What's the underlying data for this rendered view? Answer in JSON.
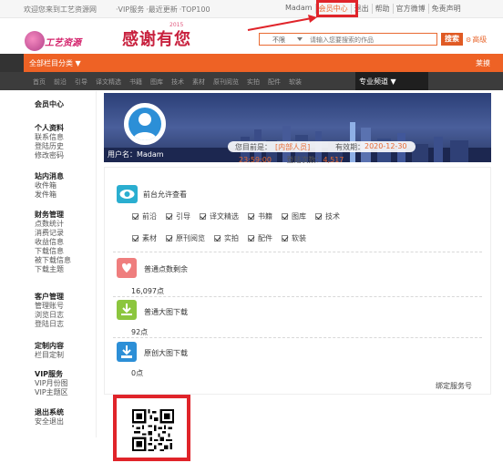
{
  "topbar": {
    "welcome": "欢迎您来到工艺资源网",
    "links_left": [
      "·VIP服务",
      "·最近更新",
      "·TOP100"
    ],
    "user": "Madam",
    "user_center": "会员中心",
    "logout": "退出",
    "help": "帮助",
    "weibo": "官方微博",
    "disclaimer": "免责声明"
  },
  "header": {
    "logo_text": "工艺资源",
    "banner_text": "感谢有您",
    "banner_year": "2015",
    "search_scope": "不限",
    "search_placeholder": "请输入您要搜索的作品",
    "search_button": "搜索",
    "advanced": "高级"
  },
  "nav": {
    "all_categories": "全部栏目分类 ▼",
    "ad": "莱摸",
    "sub_items": [
      "首页",
      "前沿",
      "引导",
      "译文精选",
      "书籍",
      "图库",
      "技术",
      "素材",
      "原刊阅览",
      "实拍",
      "配件",
      "软装"
    ],
    "professional": "专业频道 ▼"
  },
  "sidebar": {
    "title": "会员中心",
    "groups": [
      {
        "title": "个人资料",
        "items": [
          "联系信息",
          "登陆历史",
          "修改密码"
        ]
      },
      {
        "title": "站内消息",
        "items": [
          "收件箱",
          "发件箱"
        ]
      },
      {
        "title": "财务管理",
        "items": [
          "点数统计",
          "消费记录",
          "收益信息",
          "下载信息",
          "被下载信息",
          "下载主题"
        ]
      },
      {
        "title": "客户管理",
        "items": [
          "管理账号",
          "浏览日志",
          "登陆日志"
        ]
      },
      {
        "title": "定制内容",
        "items": [
          "栏目定制"
        ]
      },
      {
        "title": "VIP服务",
        "items": [
          "VIP月份图",
          "VIP主题区"
        ]
      },
      {
        "title": "退出系统",
        "items": [
          "安全退出"
        ]
      }
    ]
  },
  "profile": {
    "username_label": "用户名：",
    "username": "Madam",
    "role_label": "您目前是：",
    "role": "[内部人员]",
    "expire_label": "有效期：",
    "expire": "2020-12-30",
    "points_value": "23:59:00",
    "login_label": "登陆次数：",
    "login_count": "4,517"
  },
  "permissions": {
    "title": "前台允许查看",
    "row1": [
      "前沿",
      "引导",
      "译文精选",
      "书籍",
      "图库",
      "技术"
    ],
    "row2": [
      "素材",
      "原刊阅览",
      "实拍",
      "配件",
      "软装"
    ]
  },
  "stats": [
    {
      "label": "普通点数剩余",
      "value": "16,097点",
      "color": "#ef7e7e"
    },
    {
      "label": "普通大图下载",
      "value": "92点",
      "color": "#8cc63e"
    },
    {
      "label": "原创大图下载",
      "value": "0点",
      "color": "#2c8fd7"
    }
  ],
  "bind_service": "绑定服务号"
}
